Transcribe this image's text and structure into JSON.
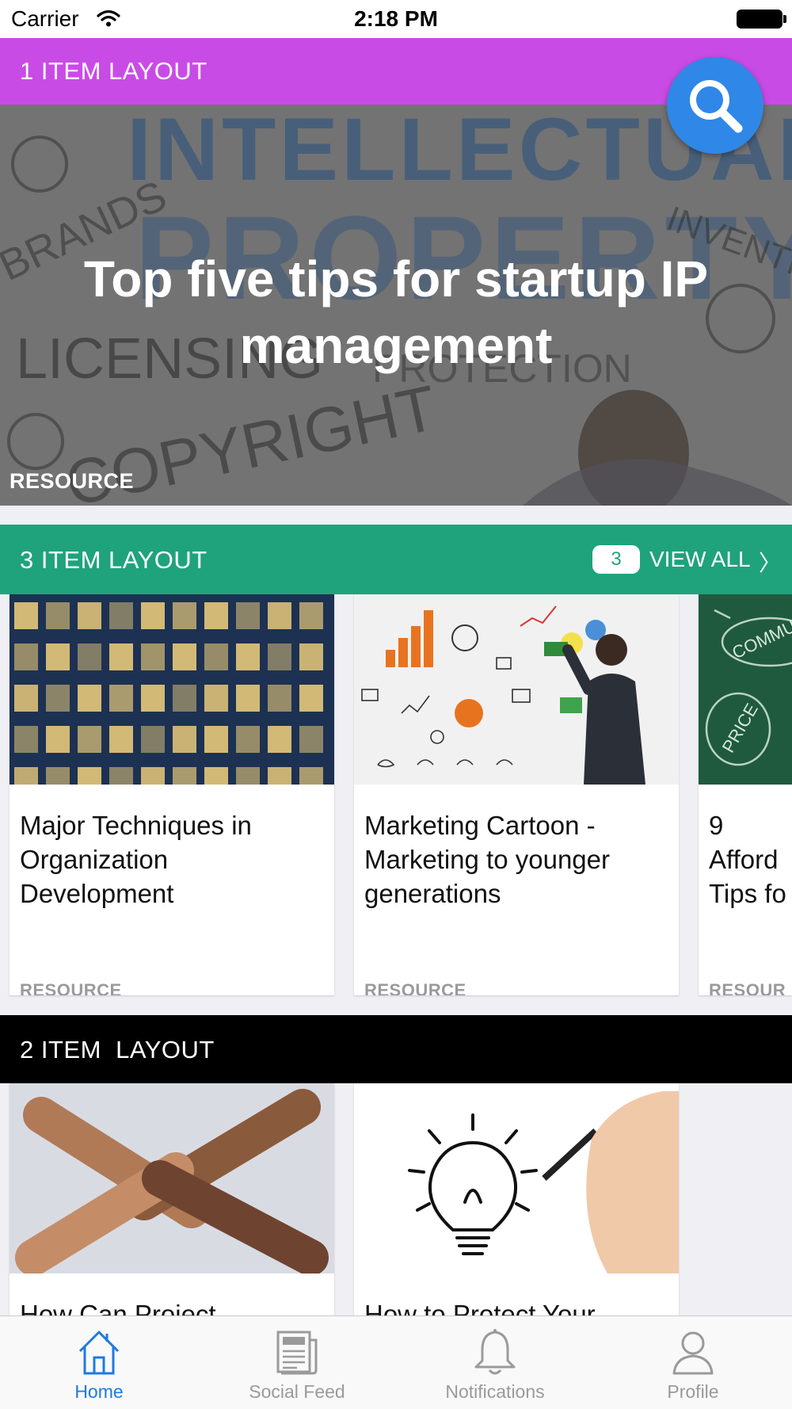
{
  "status_bar": {
    "carrier": "Carrier",
    "time": "2:18 PM"
  },
  "section_one": {
    "title": "1 ITEM LAYOUT",
    "hero": {
      "title": "Top five tips for startup IP management",
      "tag": "RESOURCE"
    }
  },
  "section_two": {
    "title": "3 ITEM LAYOUT",
    "count": "3",
    "view_all_label": "VIEW ALL",
    "view_all_chevron": "〉",
    "cards": [
      {
        "title": "Major Techniques in Organization Development",
        "tag": "RESOURCE"
      },
      {
        "title": "Marketing Cartoon - Marketing to younger generations",
        "tag": "RESOURCE"
      },
      {
        "title": "9 Afford Tips fo",
        "tag": "RESOUR"
      }
    ]
  },
  "section_three": {
    "title": "2 ITEM  LAYOUT",
    "cards": [
      {
        "title": "How Can Project"
      },
      {
        "title": "How to Protect Your"
      }
    ]
  },
  "tab_bar": {
    "active_color": "#1f7ae0",
    "inactive_color": "#9a9a9a",
    "tabs": [
      {
        "label": "Home",
        "icon": "home-icon",
        "active": true
      },
      {
        "label": "Social Feed",
        "icon": "newspaper-icon",
        "active": false
      },
      {
        "label": "Notifications",
        "icon": "bell-icon",
        "active": false
      },
      {
        "label": "Profile",
        "icon": "person-icon",
        "active": false
      }
    ]
  },
  "colors": {
    "section_one_header": "#c94be6",
    "section_two_header": "#1fa37c",
    "section_three_header": "#000000",
    "search_button": "#2f87e8"
  }
}
